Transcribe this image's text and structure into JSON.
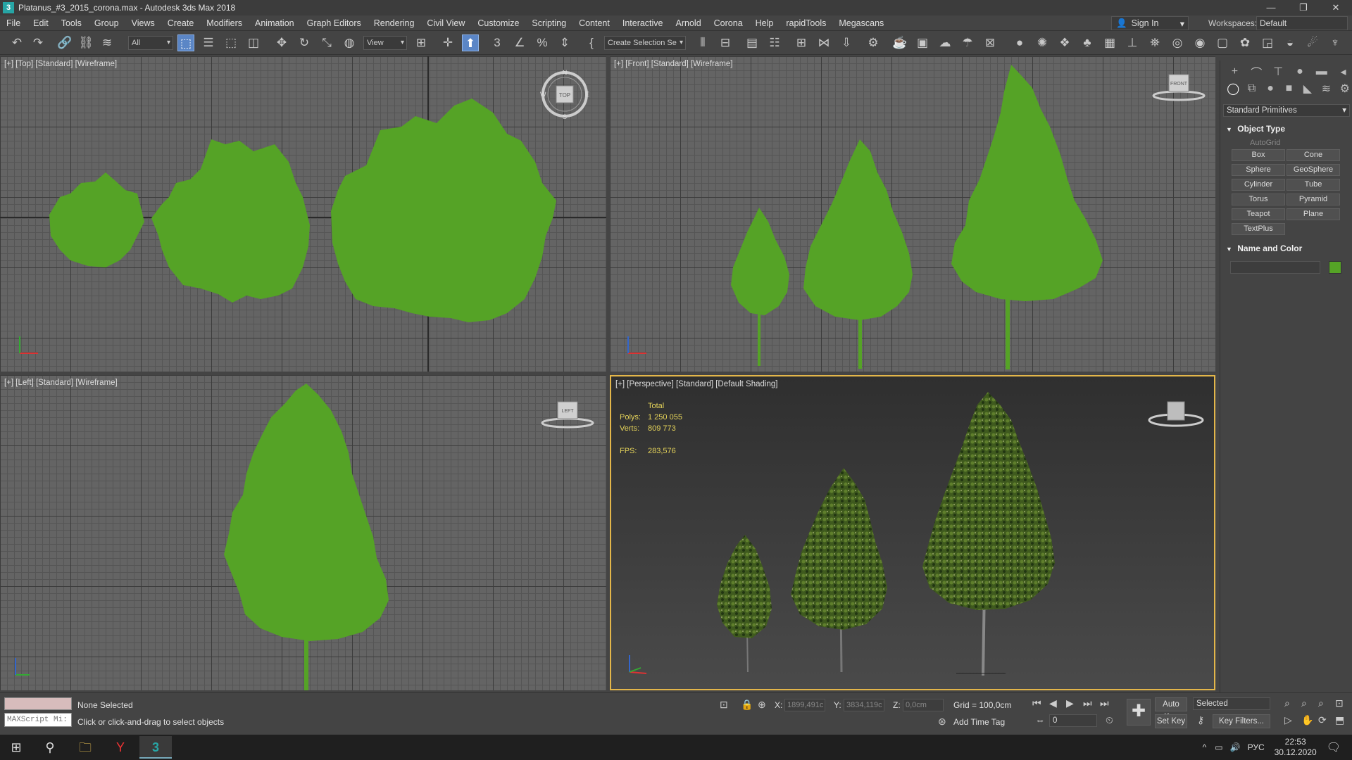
{
  "window": {
    "title": "Platanus_#3_2015_corona.max - Autodesk 3ds Max 2018"
  },
  "menu": [
    "File",
    "Edit",
    "Tools",
    "Group",
    "Views",
    "Create",
    "Modifiers",
    "Animation",
    "Graph Editors",
    "Rendering",
    "Civil View",
    "Customize",
    "Scripting",
    "Content",
    "Interactive",
    "Arnold",
    "Corona",
    "Help",
    "rapidTools",
    "Megascans"
  ],
  "account": {
    "signin": "Sign In",
    "workspaces_label": "Workspaces:",
    "workspace": "Default"
  },
  "toolbar": {
    "filter": "All",
    "refcoord": "View",
    "selset": "Create Selection Se"
  },
  "viewports": {
    "top": {
      "label": "[+] [Top] [Standard] [Wireframe]",
      "cube": "TOP",
      "compass": [
        "N",
        "S",
        "W",
        "E"
      ]
    },
    "front": {
      "label": "[+] [Front] [Standard] [Wireframe]",
      "cube": "FRONT"
    },
    "left": {
      "label": "[+] [Left] [Standard] [Wireframe]",
      "cube": "LEFT"
    },
    "persp": {
      "label": "[+] [Perspective] [Standard] [Default Shading]"
    }
  },
  "stats": {
    "total": "Total",
    "polys_label": "Polys:",
    "polys": "1 250 055",
    "verts_label": "Verts:",
    "verts": "809 773",
    "fps_label": "FPS:",
    "fps": "283,576"
  },
  "colors": {
    "tree_green": "#55a326",
    "persp_border": "#e3b64a"
  },
  "command_panel": {
    "category": "Standard Primitives",
    "object_type_title": "Object Type",
    "autogrid": "AutoGrid",
    "buttons": [
      "Box",
      "Cone",
      "Sphere",
      "GeoSphere",
      "Cylinder",
      "Tube",
      "Torus",
      "Pyramid",
      "Teapot",
      "Plane",
      "TextPlus"
    ],
    "name_color_title": "Name and Color"
  },
  "status": {
    "selection": "None Selected",
    "prompt": "Click or click-and-drag to select objects",
    "maxscript": "MAXScript Mi:",
    "x_label": "X:",
    "x": "1899,491c",
    "y_label": "Y:",
    "y": "3834,119c",
    "z_label": "Z:",
    "z": "0,0cm",
    "grid": "Grid = 100,0cm",
    "add_time_tag": "Add Time Tag",
    "frame": "0",
    "auto_key": "Auto Key",
    "set_key": "Set Key",
    "selected": "Selected",
    "key_filters": "Key Filters..."
  },
  "taskbar": {
    "lang": "РУС",
    "time": "22:53",
    "date": "30.12.2020"
  }
}
